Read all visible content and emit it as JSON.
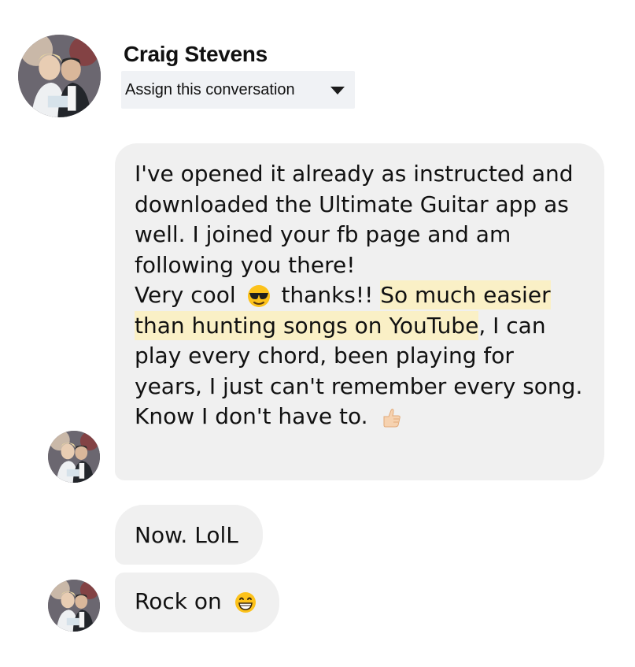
{
  "header": {
    "contact_name": "Craig Stevens",
    "assign_label": "Assign this conversation"
  },
  "icons": {
    "avatar": "profile-photo",
    "assign_caret": "caret-down-icon",
    "cool_emoji": "smiling-face-with-sunglasses",
    "thumb_emoji": "thumbs-up",
    "grin_emoji": "grinning-face-with-smiling-eyes"
  },
  "messages": [
    {
      "lines": [
        "I've opened it already as instructed and",
        "downloaded the Ultimate Guitar app as",
        "well. I joined your fb page and am",
        "following you there!"
      ],
      "line5_before": "Very cool",
      "line5_middle": "thanks!! ",
      "highlight_1": "So much easier",
      "highlight_2": "than hunting songs on YouTube",
      "line6_after": ", I can",
      "lines_after": [
        "play every chord, been playing for",
        "years, I just can't remember every song."
      ],
      "last_line": "Know I don't have to."
    },
    {
      "text": "Now. LolL"
    },
    {
      "text": "Rock on"
    }
  ],
  "colors": {
    "bubble": "#f0f0f0",
    "highlight": "#faf0c6",
    "assign_bg": "#f0f2f5"
  }
}
